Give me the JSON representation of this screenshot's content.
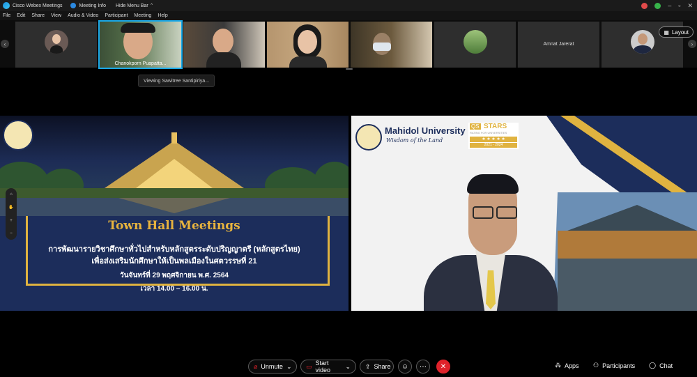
{
  "window": {
    "app_title": "Cisco Webex Meetings",
    "meeting_info": "Meeting Info",
    "hide_menu_bar": "Hide Menu Bar",
    "controls": [
      "–",
      "▫",
      "✕"
    ]
  },
  "menu": [
    "File",
    "Edit",
    "Share",
    "View",
    "Audio & Video",
    "Participant",
    "Meeting",
    "Help"
  ],
  "participants_strip": {
    "active_speaker_name": "Chanokporn Puapatta...",
    "video_off_name": "Amnat Jarerat",
    "layout_label": "Layout"
  },
  "viewing_label": "Viewing Sawitree Santipiriya...",
  "shared_slide": {
    "title": "Town Hall Meetings",
    "line1": "การพัฒนารายวิชาศึกษาทั่วไปสำหรับหลักสูตรระดับปริญญาตรี (หลักสูตรไทย)",
    "line2": "เพื่อส่งเสริมนักศึกษาให้เป็นพลเมืองในศตวรรษที่ 21",
    "date": "วันจันทร์ที่ 29 พฤศจิกายน พ.ศ. 2564",
    "time": "เวลา 14.00 – 16.00 น."
  },
  "speaker_background": {
    "university": "Mahidol University",
    "tagline": "Wisdom of the Land",
    "qs": "QS",
    "stars": "STARS",
    "rating_label": "RATING FOR UNIVERSITIES",
    "stars_years": "2021 - 2024"
  },
  "zoom_tools": [
    "⌂",
    "✋",
    "+",
    "−"
  ],
  "bottom_bar": {
    "unmute": "Unmute",
    "start_video": "Start video",
    "share": "Share",
    "apps": "Apps",
    "participants": "Participants",
    "chat": "Chat"
  },
  "colors": {
    "accent": "#1aa9e8",
    "leave": "#e0222b",
    "slide_navy": "#1c2d5b",
    "slide_gold": "#e0b340"
  }
}
